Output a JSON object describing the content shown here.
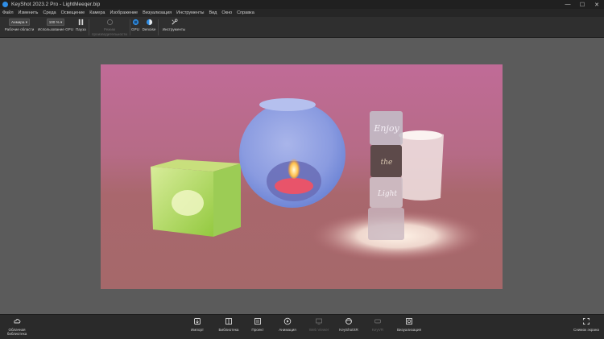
{
  "window": {
    "title": "KeyShot 2023.2 Pro - LightMeeqer.bip",
    "controls": {
      "minimize": "—",
      "maximize": "☐",
      "close": "✕"
    }
  },
  "menu": [
    "Файл",
    "Изменить",
    "Среда",
    "Освещение",
    "Камера",
    "Изображение",
    "Визуализация",
    "Инструменты",
    "Вид",
    "Окно",
    "Справка"
  ],
  "ribbon": {
    "workspace_value": "Анмира",
    "workspace_label": "Рабочие области",
    "gpu_usage_value": "100 %",
    "gpu_usage_label": "Использование GPU",
    "pause_label": "Пауза",
    "preview_label": "Режим производительности",
    "gpu_label": "GPU",
    "denoise_label": "Denoise",
    "tools_label": "Инструменты"
  },
  "bottom": {
    "cloud_library": "Облачная библиотека",
    "import": "Импорт",
    "library": "Библиотека",
    "project": "Проект",
    "animation": "Анимация",
    "web_viewer": "Web Viewer",
    "keyshot_xr": "KeyShotXR",
    "keyvr": "KeyVR",
    "render": "Визуализация",
    "screenshot": "Снимок экрана"
  },
  "icons": {
    "app": "keyshot-logo-icon",
    "pause": "pause-icon",
    "gpu": "gpu-icon",
    "denoise": "denoise-icon",
    "tools": "tools-icon",
    "cloud": "cloud-library-icon",
    "import": "import-icon",
    "library": "library-icon",
    "project": "project-icon",
    "animation": "animation-icon",
    "web_viewer": "web-viewer-icon",
    "keyshot_xr": "keyshotxr-icon",
    "keyvr": "keyvr-icon",
    "render": "render-icon",
    "screenshot": "screenshot-icon"
  },
  "scene": {
    "cube_text_top": "Enjoy",
    "cube_text_middle": "the",
    "cube_text_bottom": "Light"
  },
  "colors": {
    "accent": "#2f8ee6",
    "background": "#5b5b5b"
  }
}
